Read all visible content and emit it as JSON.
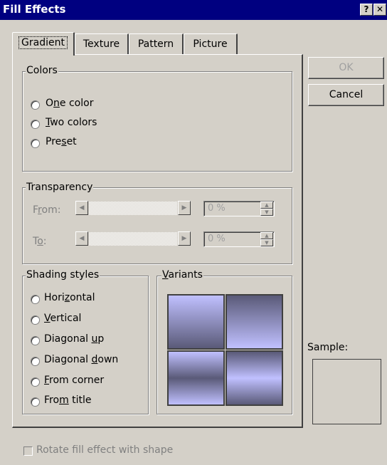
{
  "window": {
    "title": "Fill Effects",
    "help_glyph": "?",
    "close_glyph": "✕"
  },
  "tabs": [
    {
      "label": "Gradient"
    },
    {
      "label": "Texture"
    },
    {
      "label": "Pattern"
    },
    {
      "label": "Picture"
    }
  ],
  "colors_group": {
    "legend": "Colors",
    "options": [
      {
        "pre": "O",
        "mn": "n",
        "post": "e color",
        "checked": false
      },
      {
        "pre": "",
        "mn": "T",
        "post": "wo colors",
        "checked": false
      },
      {
        "pre": "Pre",
        "mn": "s",
        "post": "et",
        "checked": false
      }
    ]
  },
  "transparency_group": {
    "legend": "Transparency",
    "from": {
      "pre": "F",
      "mn": "r",
      "post": "om:",
      "value": "0 %"
    },
    "to": {
      "pre": "T",
      "mn": "o",
      "post": ":",
      "value": "0 %"
    },
    "left_arrow": "◀",
    "right_arrow": "▶",
    "up_arrow": "▲",
    "down_arrow": "▼"
  },
  "shading_group": {
    "legend": "Shading styles",
    "options": [
      {
        "pre": "Hori",
        "mn": "z",
        "post": "ontal"
      },
      {
        "pre": "",
        "mn": "V",
        "post": "ertical"
      },
      {
        "pre": "Diagonal ",
        "mn": "u",
        "post": "p"
      },
      {
        "pre": "Diagonal ",
        "mn": "d",
        "post": "own"
      },
      {
        "pre": "",
        "mn": "F",
        "post": "rom corner"
      },
      {
        "pre": "Fro",
        "mn": "m",
        "post": " title"
      }
    ]
  },
  "variants_group": {
    "legend_pre": "",
    "legend_mn": "V",
    "legend_post": "ariants",
    "colors": {
      "light": "#c0c0ff",
      "dark": "#5a5a78"
    }
  },
  "buttons": {
    "ok": "OK",
    "cancel": "Cancel"
  },
  "sample": {
    "label": "Sample:"
  },
  "rotate_checkbox": {
    "label": "Rotate fill effect with shape",
    "checked": false
  }
}
